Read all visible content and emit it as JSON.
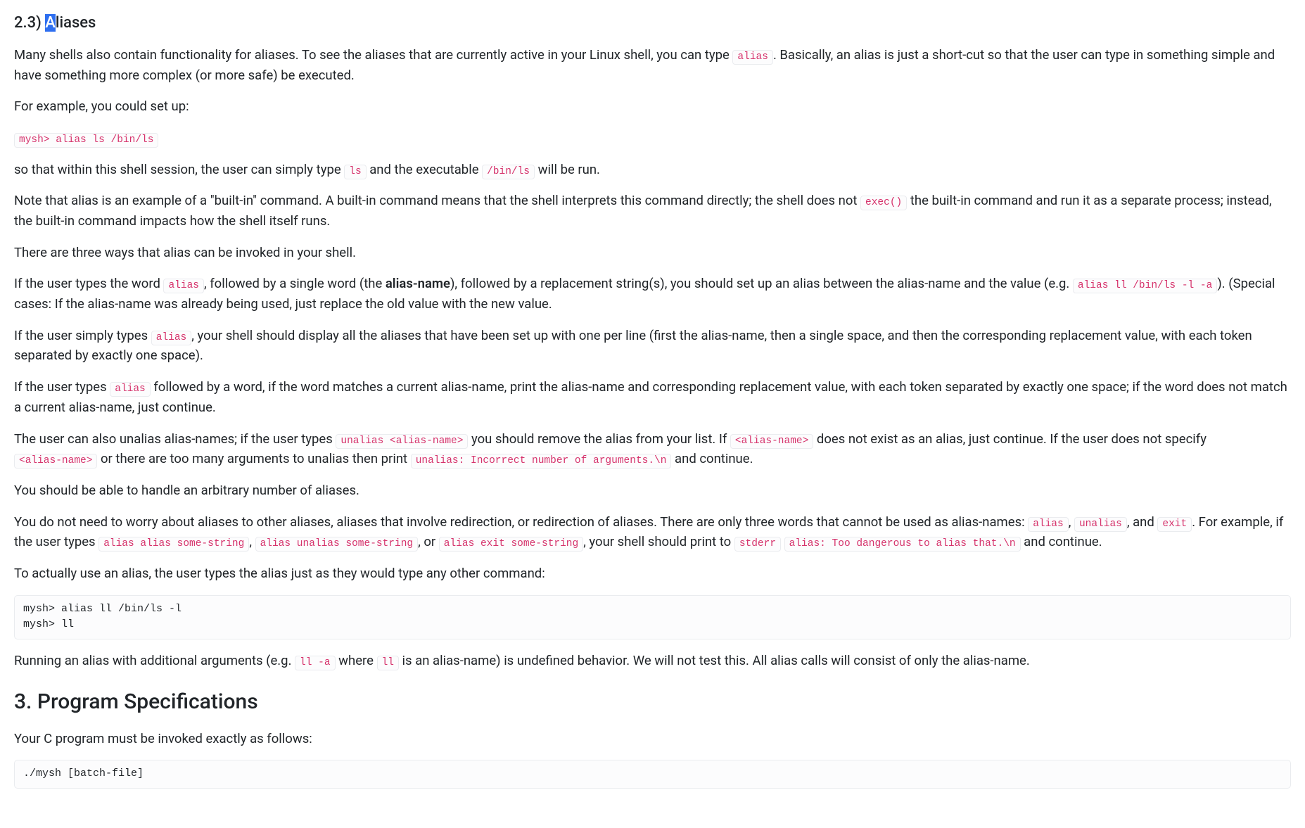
{
  "section23": {
    "heading_num": "2.3) ",
    "heading_sel": "A",
    "heading_rest": "liases",
    "p1_a": "Many shells also contain functionality for aliases.   To see the aliases that are currently active in your Linux shell, you can type ",
    "p1_code1": "alias",
    "p1_b": ".   Basically, an alias is just a short-cut so that the user can type in something simple and have something more complex (or more safe) be executed.",
    "p2": "For example, you could set up:",
    "code_block1": "mysh> alias ls /bin/ls",
    "p3_a": "so that within this shell session, the user can simply type ",
    "p3_code1": "ls",
    "p3_b": " and the executable ",
    "p3_code2": "/bin/ls",
    "p3_c": " will be run.",
    "p4_a": "Note that alias is an example of a \"built-in\" command. A built-in command means that the shell interprets this command directly; the shell does not ",
    "p4_code1": "exec()",
    "p4_b": " the built-in command and run it as a separate process; instead, the built-in command impacts how the shell itself runs.",
    "p5": "There are three ways that alias can be invoked in your shell.",
    "p6_a": "If the user types the word ",
    "p6_code1": "alias",
    "p6_b": ", followed by a single word (the ",
    "p6_strong": "alias-name",
    "p6_c": "), followed by a replacement string(s), you should set up an alias between the alias-name and the value (e.g. ",
    "p6_code2": "alias ll /bin/ls -l -a",
    "p6_d": "). (Special cases: If the alias-name was already being used, just replace the old value with the new value.",
    "p7_a": "If the user simply types ",
    "p7_code1": "alias",
    "p7_b": ", your shell should display all the aliases that have been set up with one per line (first the alias-name, then a single space, and then the corresponding replacement value, with each token separated by exactly one space).",
    "p8_a": "If the user types ",
    "p8_code1": "alias",
    "p8_b": " followed by a word, if the word matches a current alias-name, print the alias-name and corresponding replacement value, with each token separated by exactly one space; if the word does not match a current alias-name, just continue.",
    "p9_a": "The user can also unalias alias-names; if the user types ",
    "p9_code1": "unalias <alias-name>",
    "p9_b": " you should remove the alias from your list. If ",
    "p9_code2": "<alias-name>",
    "p9_c": " does not exist as an alias, just continue. If the user does not specify ",
    "p9_code3": "<alias-name>",
    "p9_d": " or there are too many arguments to unalias then print ",
    "p9_code4": "unalias: Incorrect number of arguments.\\n",
    "p9_e": " and continue.",
    "p10": "You should be able to handle an arbitrary number of aliases.",
    "p11_a": "You do not need to worry about aliases to other aliases, aliases that involve redirection, or redirection of aliases. There are only three words that cannot be used as alias-names: ",
    "p11_code1": "alias",
    "p11_b": ", ",
    "p11_code2": "unalias",
    "p11_c": ", and ",
    "p11_code3": "exit",
    "p11_d": ". For example, if the user types ",
    "p11_code4": "alias alias some-string",
    "p11_e": ", ",
    "p11_code5": "alias unalias some-string",
    "p11_f": ", or ",
    "p11_code6": "alias exit some-string",
    "p11_g": ", your shell should print to ",
    "p11_code7": "stderr",
    "p11_h": " ",
    "p11_code8": "alias: Too dangerous to alias that.\\n",
    "p11_i": " and continue.",
    "p12": "To actually use an alias, the user types the alias just as they would type any other command:",
    "code_block2": "mysh> alias ll /bin/ls -l\nmysh> ll",
    "p13_a": "Running an alias with additional arguments (e.g. ",
    "p13_code1": "ll -a",
    "p13_b": " where ",
    "p13_code2": "ll",
    "p13_c": " is an alias-name) is undefined behavior. We will not test this. All alias calls will consist of only the alias-name."
  },
  "section3": {
    "heading": "3. Program Specifications",
    "p1": "Your C program must be invoked exactly as follows:",
    "code_block": "./mysh [batch-file]"
  }
}
